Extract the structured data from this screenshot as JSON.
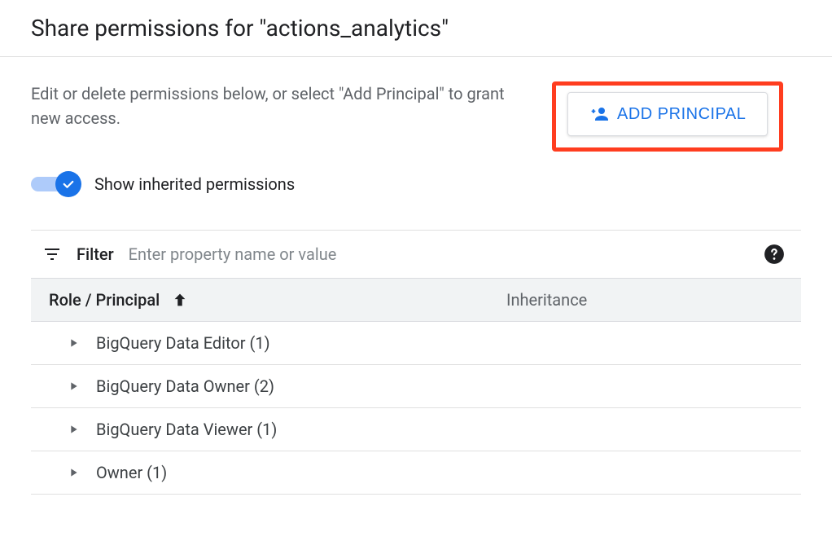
{
  "page": {
    "title": "Share permissions for \"actions_analytics\"",
    "description": "Edit or delete permissions below, or select \"Add Principal\" to grant new access."
  },
  "buttons": {
    "add_principal": "ADD PRINCIPAL"
  },
  "toggle": {
    "label": "Show inherited permissions",
    "checked": true
  },
  "filter": {
    "label": "Filter",
    "placeholder": "Enter property name or value"
  },
  "table": {
    "columns": {
      "role": "Role / Principal",
      "inheritance": "Inheritance"
    },
    "rows": [
      {
        "label": "BigQuery Data Editor (1)"
      },
      {
        "label": "BigQuery Data Owner (2)"
      },
      {
        "label": "BigQuery Data Viewer (1)"
      },
      {
        "label": "Owner (1)"
      }
    ]
  }
}
